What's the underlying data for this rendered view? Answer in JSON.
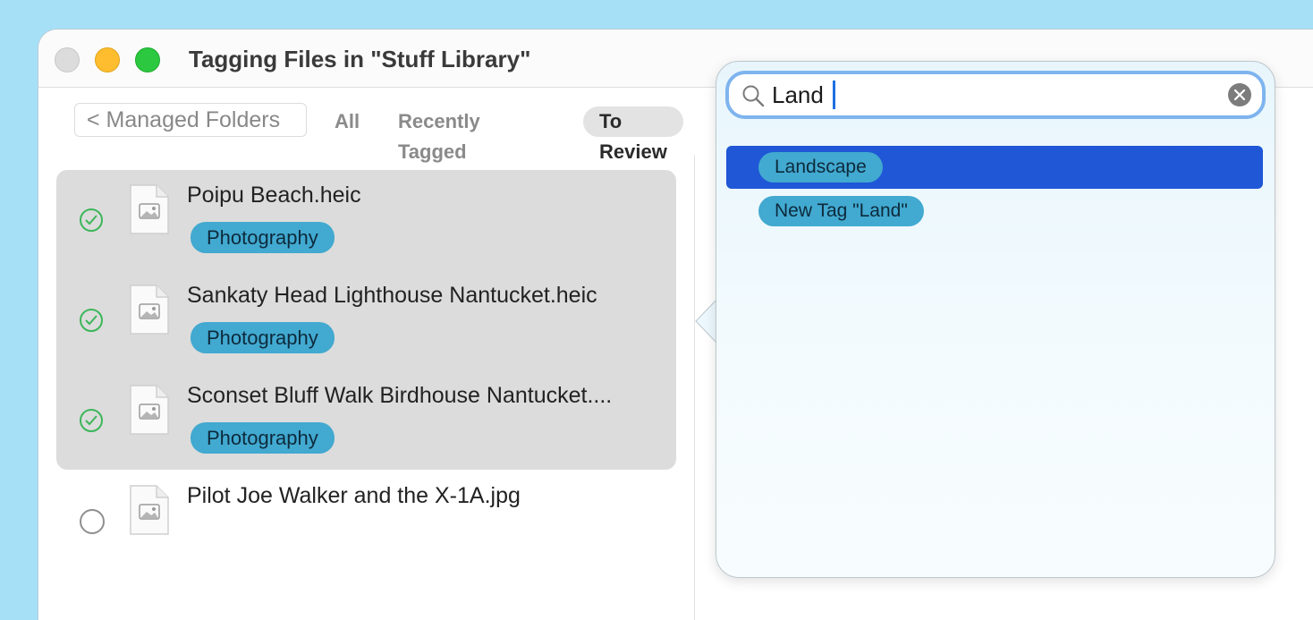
{
  "window": {
    "title": "Tagging Files in \"Stuff Library\""
  },
  "toolbar": {
    "back_label": "< Managed Folders",
    "tabs": [
      {
        "label": "All",
        "selected": false
      },
      {
        "label": "Recently Tagged",
        "selected": false
      },
      {
        "label": "To Review",
        "selected": true
      }
    ]
  },
  "files": [
    {
      "name": "Poipu Beach.heic",
      "tag": "Photography",
      "checked": true
    },
    {
      "name": "Sankaty Head Lighthouse Nantucket.heic",
      "tag": "Photography",
      "checked": true
    },
    {
      "name": "Sconset Bluff Walk Birdhouse Nantucket....",
      "tag": "Photography",
      "checked": true
    },
    {
      "name": "Pilot Joe Walker and the X-1A.jpg",
      "tag": "",
      "checked": false
    }
  ],
  "popover": {
    "search_value": "Land",
    "suggestions": [
      {
        "label": "Landscape",
        "selected": true
      },
      {
        "label": "New Tag \"Land\"",
        "selected": false
      }
    ]
  },
  "colors": {
    "tag_pill": "#42a9d0",
    "selection_highlight": "#1f57d6",
    "check_green": "#3cb65a",
    "search_focus_ring": "#7eb4ee"
  }
}
